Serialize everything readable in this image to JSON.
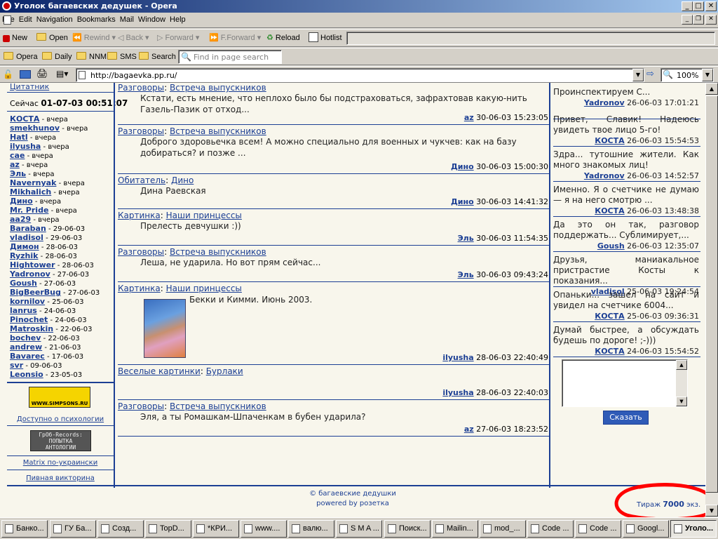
{
  "window": {
    "title": "Уголок багаевских дедушек - Opera"
  },
  "menu": [
    "File",
    "Edit",
    "Navigation",
    "Bookmarks",
    "Mail",
    "Window",
    "Help"
  ],
  "toolbar": {
    "new": "New",
    "open": "Open",
    "rewind": "Rewind",
    "back": "Back",
    "forward": "Forward",
    "fforward": "F.Forward",
    "reload": "Reload",
    "hotlist": "Hotlist"
  },
  "personal_bar": {
    "items": [
      "Opera",
      "Daily",
      "NNM",
      "SMS",
      "Search"
    ],
    "search_placeholder": "Find in page search"
  },
  "address": {
    "url": "http://bagaevka.pp.ru/",
    "zoom": "100%"
  },
  "left": {
    "top_link": "Цитатник",
    "now_label": "Сейчас",
    "now_time": "01-07-03 00:51:07",
    "users": [
      {
        "name": "КОСТА",
        "when": "вчера"
      },
      {
        "name": "smekhunov",
        "when": "вчера"
      },
      {
        "name": "Hatl",
        "when": "вчера"
      },
      {
        "name": "ilyusha",
        "when": "вчера"
      },
      {
        "name": "cae",
        "when": "вчера"
      },
      {
        "name": "az",
        "when": "вчера"
      },
      {
        "name": "Эль",
        "when": "вчера"
      },
      {
        "name": "Navernyak",
        "when": "вчера"
      },
      {
        "name": "Mikhalich",
        "when": "вчера"
      },
      {
        "name": "Дино",
        "when": "вчера"
      },
      {
        "name": "Mr. Pride",
        "when": "вчера"
      },
      {
        "name": "aa29",
        "when": "вчера"
      },
      {
        "name": "Baraban",
        "when": "29-06-03"
      },
      {
        "name": "vladisol",
        "when": "29-06-03"
      },
      {
        "name": "Димон",
        "when": "28-06-03"
      },
      {
        "name": "Ryzhik",
        "when": "28-06-03"
      },
      {
        "name": "Hightower",
        "when": "28-06-03"
      },
      {
        "name": "Yadronov",
        "when": "27-06-03"
      },
      {
        "name": "Goush",
        "when": "27-06-03"
      },
      {
        "name": "BigBeerBug",
        "when": "27-06-03"
      },
      {
        "name": "kornilov",
        "when": "25-06-03"
      },
      {
        "name": "lanrus",
        "when": "24-06-03"
      },
      {
        "name": "Pinochet",
        "when": "24-06-03"
      },
      {
        "name": "Matroskin",
        "when": "22-06-03"
      },
      {
        "name": "bochev",
        "when": "22-06-03"
      },
      {
        "name": "andrew",
        "when": "21-06-03"
      },
      {
        "name": "Bavarec",
        "when": "17-06-03"
      },
      {
        "name": "svr",
        "when": "09-06-03"
      },
      {
        "name": "Leonsio",
        "when": "23-05-03"
      }
    ],
    "banner1": "WWW.SIMPSONS.RU",
    "link1": "Доступно о психологии",
    "banner2_line1": "ГрОб-Records:",
    "banner2_line2": "ПОПЫТКА",
    "banner2_line3": "АНТОЛОГИИ",
    "link2": "Matrix по-украински",
    "link3": "Пивная викторина"
  },
  "posts": [
    {
      "cat": "Разговоры",
      "topic": "Встреча выпускников",
      "text": "Кстати, есть мнение, что неплохо было бы подстраховаться, зафрахтовав какую-нить Газель-Пазик от отход...",
      "author": "az",
      "date": "30-06-03 15:23:05"
    },
    {
      "cat": "Разговоры",
      "topic": "Встреча выпускников",
      "text": "Доброго здоровьечка всем! А можно специально для военных и чукчев: как на базу добираться? и позже ...",
      "author": "Дино",
      "date": "30-06-03 15:00:30"
    },
    {
      "cat": "Обитатель",
      "topic": "Дино",
      "text": "Дина Раевская",
      "author": "Дино",
      "date": "30-06-03 14:41:32"
    },
    {
      "cat": "Картинка",
      "topic": "Наши принцессы",
      "text": "Прелесть девчушки :))",
      "author": "Эль",
      "date": "30-06-03 11:54:35"
    },
    {
      "cat": "Разговоры",
      "topic": "Встреча выпускников",
      "text": "Леша, не ударила. Но вот прям сейчас...",
      "author": "Эль",
      "date": "30-06-03 09:43:24"
    },
    {
      "cat": "Картинка",
      "topic": "Наши принцессы",
      "text": "Бекки и Кимми. Июнь 2003.",
      "author": "ilyusha",
      "date": "28-06-03 22:40:49"
    },
    {
      "cat": "Веселые картинки",
      "topic": "Бурлаки",
      "text": "",
      "author": "ilyusha",
      "date": "28-06-03 22:40:03"
    },
    {
      "cat": "Разговоры",
      "topic": "Встреча выпускников",
      "text": "Эля, а ты Ромашкам-Шпаченкам в бубен ударила?",
      "author": "az",
      "date": "27-06-03 18:23:52"
    }
  ],
  "right": {
    "messages": [
      {
        "text": "Проинспектируем С...",
        "author": "Yadronov",
        "date": "26-06-03 17:01:21"
      },
      {
        "text": "Привет, Славик! Надеюсь увидеть твое лицо 5-го!",
        "author": "КОСТА",
        "date": "26-06-03 15:54:53"
      },
      {
        "text": "Здра... тутошние жители. Как много знакомых лиц!",
        "author": "Yadronov",
        "date": "26-06-03 14:52:57"
      },
      {
        "text": "Именно. Я о счетчике не думаю — я на него смотрю ...",
        "author": "КОСТА",
        "date": "26-06-03 13:48:38"
      },
      {
        "text": "Да это он так, разговор поддержать... Сублимирует,...",
        "author": "Goush",
        "date": "26-06-03 12:35:07"
      },
      {
        "text": "Друзья, маниакальное пристрастие Косты к показания...",
        "author": "vladisol",
        "date": "25-06-03 19:24:54"
      },
      {
        "text": "Опаньки... зашел на сайт и увидел на счетчике 6004...",
        "author": "КОСТА",
        "date": "25-06-03 09:36:31"
      },
      {
        "text": "Думай быстрее, а обсуждать будешь по дороге! ;-)))",
        "author": "КОСТА",
        "date": "24-06-03 15:54:52"
      }
    ],
    "say_button": "Сказать"
  },
  "footer": {
    "copyright": "© багаевские дедушки",
    "powered": "powered by розетка",
    "circ_label": "Тираж",
    "circ_value": "7000",
    "circ_unit": "экз."
  },
  "taskbar": [
    "Банко...",
    "ГУ Ба...",
    "Созд...",
    "TopD...",
    "*КРИ...",
    "www....",
    "валю...",
    "S M A ...",
    "Поиск...",
    "Mailin...",
    "mod_...",
    "Code ...",
    "Code ...",
    "Googl...",
    "Уголо..."
  ],
  "colors": {
    "link": "#1c3f94",
    "page_bg": "#f8f6ec",
    "annotation": "#ff0000"
  }
}
